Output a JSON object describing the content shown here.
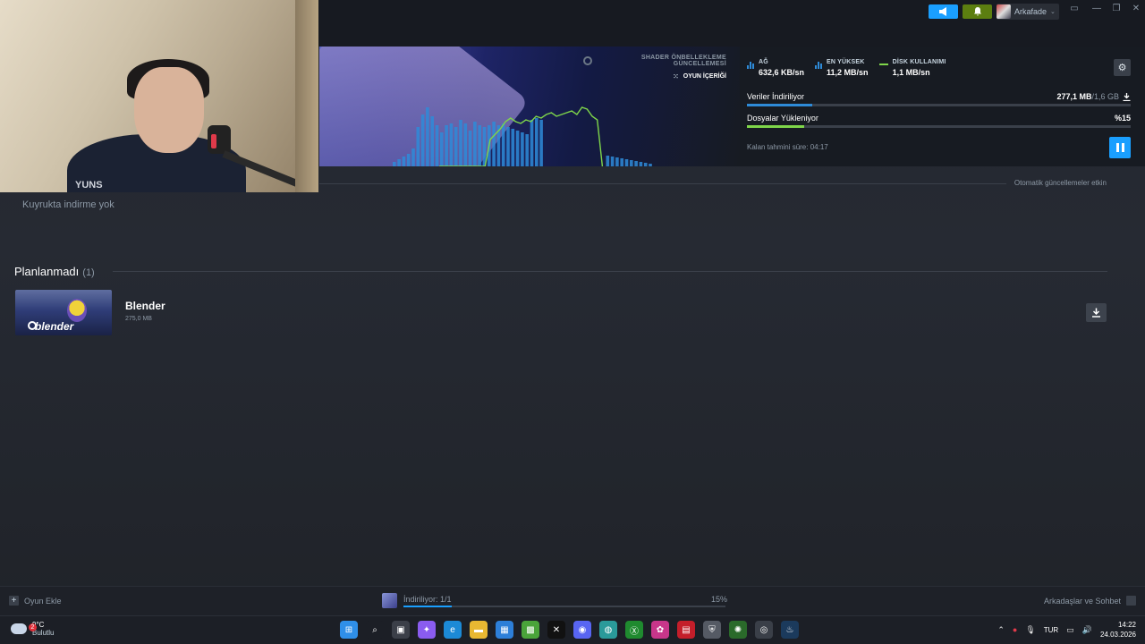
{
  "topbar": {
    "user_name": "Arkafade",
    "window_controls": [
      "▭",
      "—",
      "❐",
      "✕"
    ]
  },
  "download_panel": {
    "shader_label": "SHADER ÖNBELLEKLEME GÜNCELLEMESİ",
    "content_label": "OYUN İÇERİĞİ",
    "stats": [
      {
        "label": "AĞ",
        "value": "632,6 KB/sn"
      },
      {
        "label": "EN YÜKSEK",
        "value": "11,2 MB/sn"
      },
      {
        "label": "DİSK KULLANIMI",
        "value": "1,1 MB/sn"
      }
    ],
    "downloading_label": "Veriler İndiriliyor",
    "downloaded_amount": "277,1 MB",
    "total_amount": "/1,6 GB",
    "download_progress": 0.17,
    "installing_label": "Dosyalar Yükleniyor",
    "install_percent": "%15",
    "install_progress": 0.15,
    "eta": "Kalan tahmini süre: 04:17",
    "graph_bars": [
      5,
      8,
      11,
      14,
      20,
      44,
      58,
      66,
      56,
      46,
      38,
      46,
      48,
      44,
      52,
      48,
      40,
      50,
      46,
      44,
      46,
      50,
      46,
      48,
      44,
      42,
      40,
      38,
      36,
      52,
      54,
      52,
      0,
      0,
      0,
      0,
      0,
      0,
      0,
      0,
      0,
      0,
      0,
      0,
      0,
      12,
      11,
      10,
      9,
      8,
      7,
      6,
      5,
      4,
      3
    ],
    "graph_line": [
      0,
      0,
      0,
      0,
      0,
      0,
      0,
      0,
      0,
      0,
      30,
      36,
      42,
      50,
      54,
      50,
      48,
      52,
      50,
      56,
      54,
      58,
      60,
      56,
      58,
      60,
      62,
      58,
      66,
      64,
      56,
      52,
      0
    ]
  },
  "auto_updates": "Otomatik güncellemeler etkin",
  "queue_empty": "Kuyrukta indirme yok",
  "unscheduled": {
    "title": "Planlanmadı",
    "count": "(1)",
    "game": {
      "name": "Blender",
      "size": "275,0 MB",
      "logo": "blender"
    }
  },
  "webcam": {
    "shirt_text": "YUNS"
  },
  "bottombar": {
    "add_game": "Oyun Ekle",
    "downloading": "İndiriliyor: 1/1",
    "percent": "15%",
    "progress": 0.15,
    "friends": "Arkadaşlar ve Sohbet"
  },
  "taskbar": {
    "weather_badge": "2",
    "temp": "9°C",
    "weather": "Bulutlu",
    "lang": "TUR",
    "time": "14:22",
    "date": "24.03.2026",
    "apps": [
      {
        "name": "start-icon",
        "color": "#2f8fe8",
        "glyph": "⊞"
      },
      {
        "name": "search-icon",
        "color": "#1c1f26",
        "glyph": "⌕"
      },
      {
        "name": "task-view-icon",
        "color": "#3b3f48",
        "glyph": "▣"
      },
      {
        "name": "copilot-icon",
        "color": "#8a5cf0",
        "glyph": "✦"
      },
      {
        "name": "edge-icon",
        "color": "#1c8ad6",
        "glyph": "e"
      },
      {
        "name": "file-explorer-icon",
        "color": "#e8b832",
        "glyph": "▬"
      },
      {
        "name": "store-icon",
        "color": "#2d7fd8",
        "glyph": "▦"
      },
      {
        "name": "minecraft-icon",
        "color": "#4aa43a",
        "glyph": "▩"
      },
      {
        "name": "capcut-icon",
        "color": "#111111",
        "glyph": "✕"
      },
      {
        "name": "discord-icon",
        "color": "#5865f2",
        "glyph": "◉"
      },
      {
        "name": "browser-icon",
        "color": "#2a9a9a",
        "glyph": "◍"
      },
      {
        "name": "xbox-icon",
        "color": "#1f8a2f",
        "glyph": "Ⓧ"
      },
      {
        "name": "m365-icon",
        "color": "#c8368a",
        "glyph": "✿"
      },
      {
        "name": "video-editor-icon",
        "color": "#c41e2a",
        "glyph": "▤"
      },
      {
        "name": "shield-icon",
        "color": "#555a64",
        "glyph": "⛨"
      },
      {
        "name": "green-app-icon",
        "color": "#2a6a2a",
        "glyph": "✺"
      },
      {
        "name": "steam-alt-icon",
        "color": "#3a3f48",
        "glyph": "◎"
      },
      {
        "name": "steam-icon",
        "color": "#1b3a5c",
        "glyph": "♨"
      }
    ]
  },
  "colors": {
    "accent": "#1a9fff",
    "network": "#2e8bd8",
    "disk": "#7fd64a",
    "notify": "#5c7e10"
  }
}
